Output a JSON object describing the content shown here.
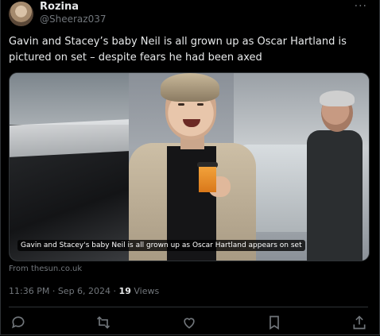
{
  "user": {
    "name": "Rozina",
    "handle": "@Sheeraz037"
  },
  "menu": {
    "more": "···"
  },
  "tweet": {
    "text": "Gavin and Stacey’s baby Neil is all grown up as Oscar Hartland is pictured on set – despite fears he had been axed",
    "media_caption": "Gavin and Stacey's baby Neil is all grown up as Oscar Hartland appears on set",
    "source": "From thesun.co.uk",
    "time": "11:36 PM",
    "date": "Sep 6, 2024",
    "separator": "·",
    "views_count": "19",
    "views_label": "Views"
  },
  "actions": [
    {
      "icon": "reply-icon"
    },
    {
      "icon": "retweet-icon"
    },
    {
      "icon": "like-icon"
    },
    {
      "icon": "bookmark-icon"
    },
    {
      "icon": "share-icon"
    }
  ],
  "colors": {
    "background": "#000000",
    "text": "#e7e9ea",
    "muted": "#71767b",
    "border": "#2f3336"
  }
}
